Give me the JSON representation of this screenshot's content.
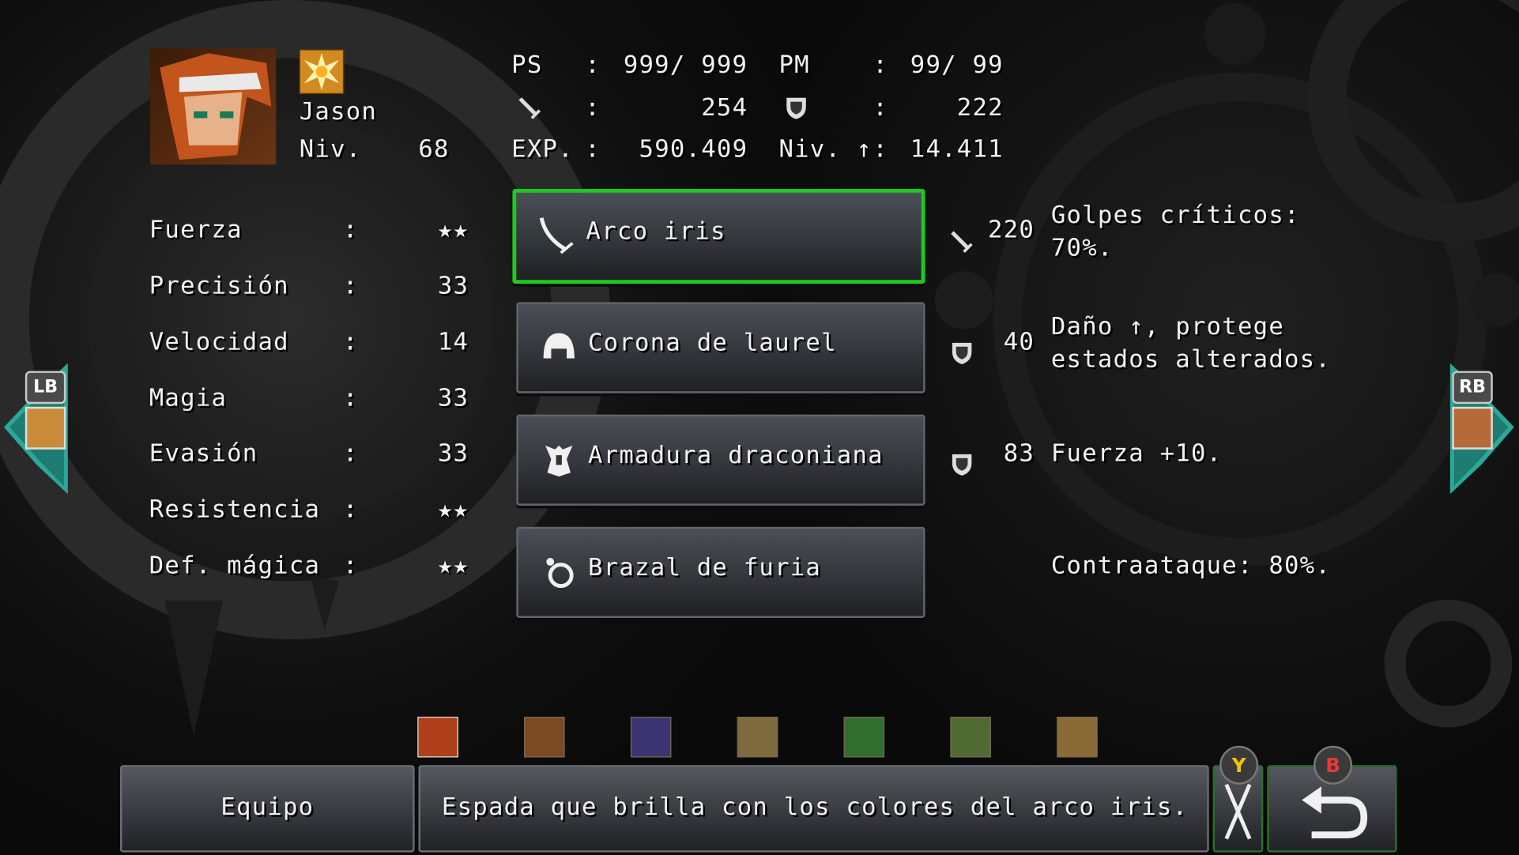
{
  "character": {
    "name": "Jason",
    "level_label": "Niv.",
    "level": "68"
  },
  "stats_header": {
    "ps_label": "PS",
    "ps_value": "999/ 999",
    "pm_label": "PM",
    "pm_value": "99/ 99",
    "attack_value": "254",
    "defense_value": "222",
    "exp_label": "EXP.",
    "exp_value": "590.409",
    "next_label": "Niv. ↑",
    "next_value": "14.411",
    "colon": ":"
  },
  "attributes": [
    {
      "label": "Fuerza",
      "value": "★★"
    },
    {
      "label": "Precisión",
      "value": "33"
    },
    {
      "label": "Velocidad",
      "value": "14"
    },
    {
      "label": "Magia",
      "value": "33"
    },
    {
      "label": "Evasión",
      "value": "33"
    },
    {
      "label": "Resistencia",
      "value": "★★"
    },
    {
      "label": "Def. mágica",
      "value": "★★"
    }
  ],
  "equipment": [
    {
      "name": "Arco iris",
      "icon": "sword-icon",
      "stat_icon": "attack-icon",
      "stat": "220",
      "desc": "Golpes críticos:\n70%.",
      "selected": true
    },
    {
      "name": "Corona de laurel",
      "icon": "helmet-icon",
      "stat_icon": "shield-icon",
      "stat": "40",
      "desc": "Daño ↑, protege\nestados alterados.",
      "selected": false
    },
    {
      "name": "Armadura draconiana",
      "icon": "armor-icon",
      "stat_icon": "shield-icon",
      "stat": "83",
      "desc": "Fuerza +10.",
      "selected": false
    },
    {
      "name": "Brazal de furia",
      "icon": "accessory-icon",
      "stat_icon": "",
      "stat": "",
      "desc": "Contraataque: 80%.",
      "selected": false
    }
  ],
  "party": [
    "crono-portrait",
    "marle-portrait",
    "magus-portrait",
    "ayla-portrait",
    "frog-portrait",
    "lucca-portrait",
    "marle-alt-portrait"
  ],
  "nav": {
    "lb": "LB",
    "rb": "RB"
  },
  "bottom": {
    "menu_label": "Equipo",
    "description": "Espada que brilla con los colores del arco iris.",
    "y_badge": "Y",
    "b_badge": "B"
  },
  "colors": {
    "selection": "#21c822",
    "nav_arrow": "#2aa89a"
  }
}
